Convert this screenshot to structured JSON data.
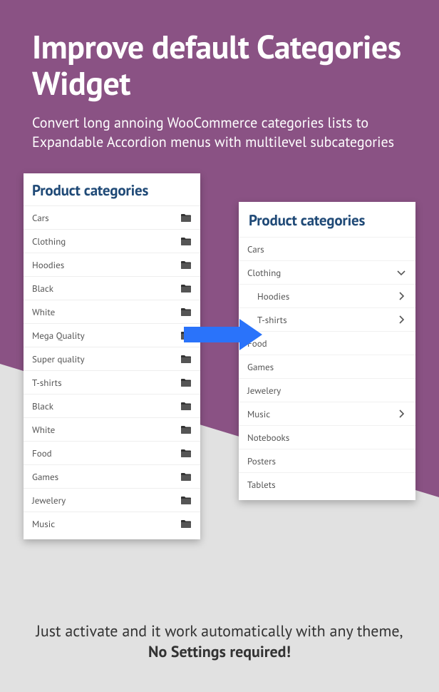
{
  "title": "Improve default Categories Widget",
  "subtitle": "Convert long annoing WooCommerce categories lists to Expandable Accordion menus with multilevel subcategories",
  "panel_title": "Product categories",
  "left_items": [
    {
      "label": "Cars",
      "icon": "folder"
    },
    {
      "label": "Clothing",
      "icon": "folder"
    },
    {
      "label": "Hoodies",
      "icon": "folder"
    },
    {
      "label": "Black",
      "icon": "folder"
    },
    {
      "label": "White",
      "icon": "folder"
    },
    {
      "label": "Mega Quality",
      "icon": "folder"
    },
    {
      "label": "Super quality",
      "icon": "folder"
    },
    {
      "label": "T-shirts",
      "icon": "folder"
    },
    {
      "label": "Black",
      "icon": "folder"
    },
    {
      "label": "White",
      "icon": "folder"
    },
    {
      "label": "Food",
      "icon": "folder"
    },
    {
      "label": "Games",
      "icon": "folder"
    },
    {
      "label": "Jewelery",
      "icon": "folder"
    },
    {
      "label": "Music",
      "icon": "folder"
    }
  ],
  "right_items": [
    {
      "label": "Cars",
      "icon": "",
      "indent": false
    },
    {
      "label": "Clothing",
      "icon": "chevron-down",
      "indent": false
    },
    {
      "label": "Hoodies",
      "icon": "chevron-right",
      "indent": true
    },
    {
      "label": "T-shirts",
      "icon": "chevron-right",
      "indent": true
    },
    {
      "label": "Food",
      "icon": "",
      "indent": false
    },
    {
      "label": "Games",
      "icon": "",
      "indent": false
    },
    {
      "label": "Jewelery",
      "icon": "",
      "indent": false
    },
    {
      "label": "Music",
      "icon": "chevron-right",
      "indent": false
    },
    {
      "label": "Notebooks",
      "icon": "",
      "indent": false
    },
    {
      "label": "Posters",
      "icon": "",
      "indent": false
    },
    {
      "label": "Tablets",
      "icon": "",
      "indent": false
    }
  ],
  "footer_line1": "Just activate and it work automatically with any theme,",
  "footer_line2": "No Settings required!"
}
